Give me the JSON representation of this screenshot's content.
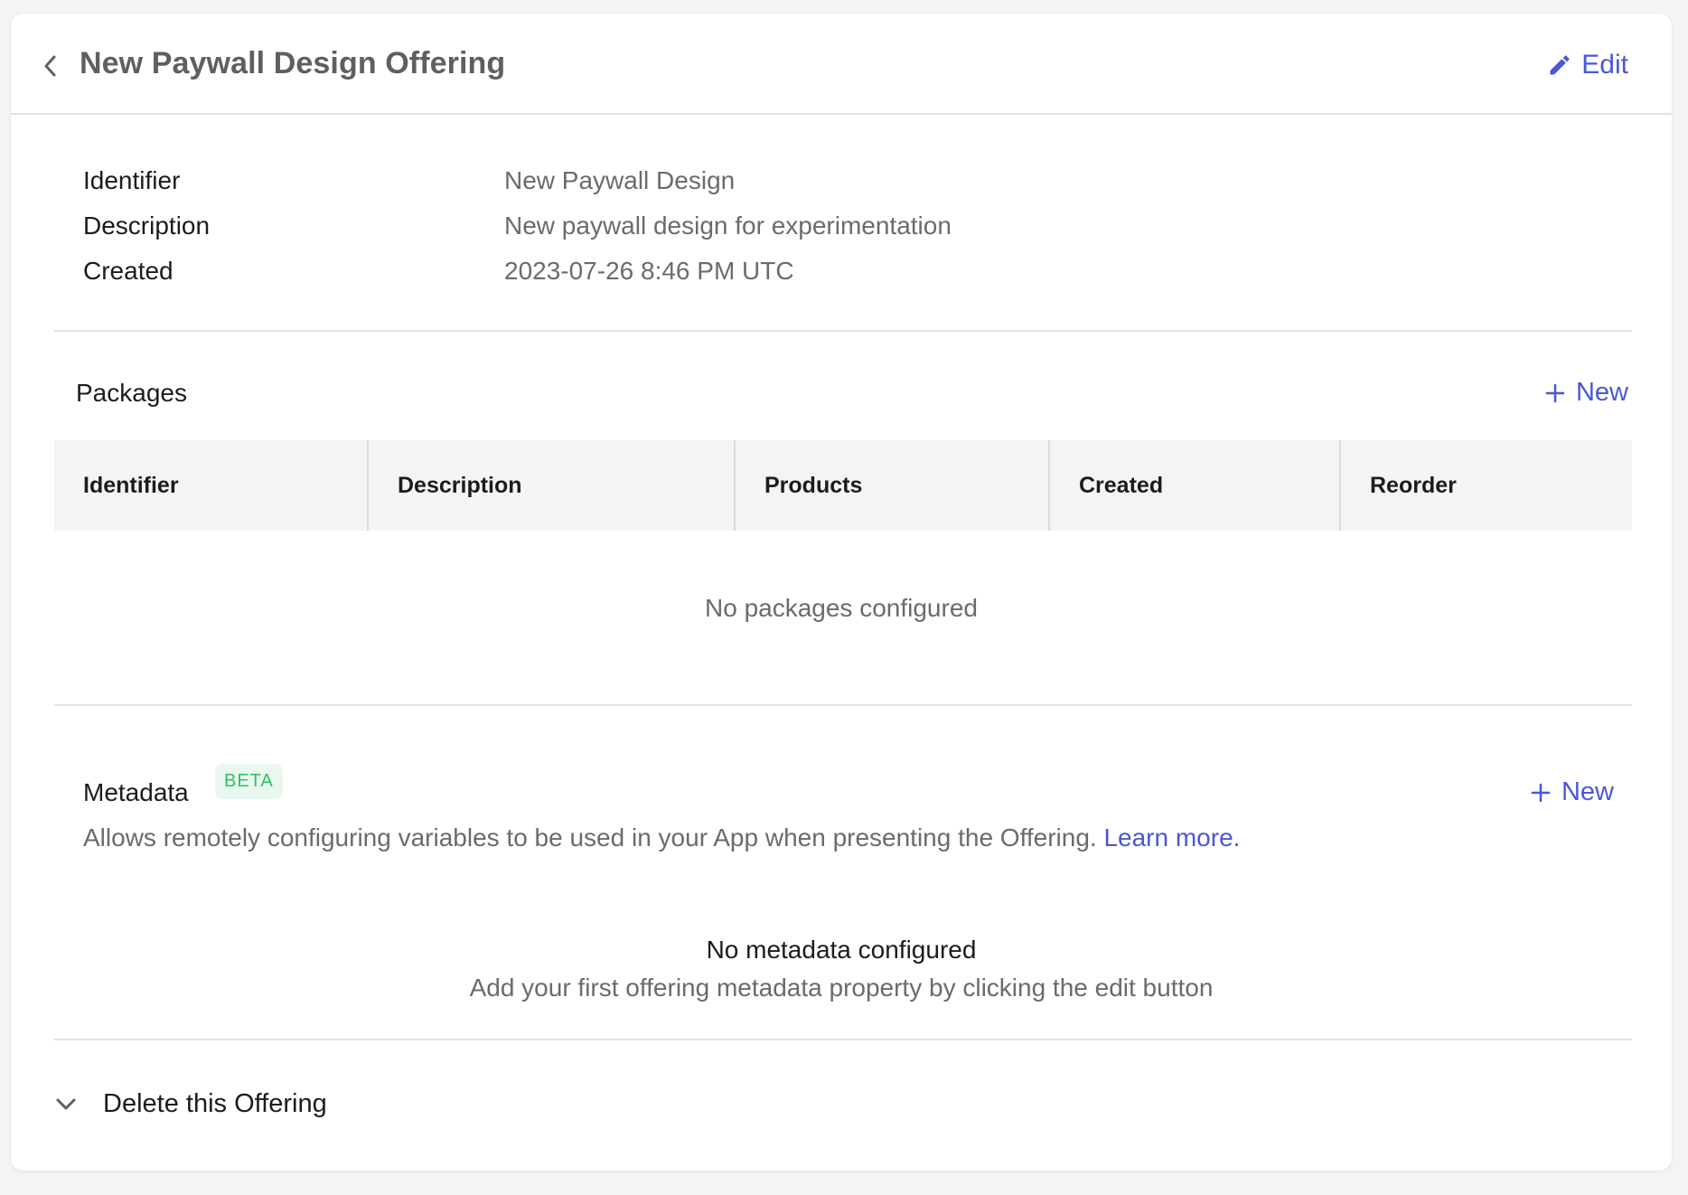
{
  "header": {
    "title": "New Paywall Design Offering",
    "edit_label": "Edit"
  },
  "info": [
    {
      "label": "Identifier",
      "value": "New Paywall Design"
    },
    {
      "label": "Description",
      "value": "New paywall design for experimentation"
    },
    {
      "label": "Created",
      "value": "2023-07-26 8:46 PM UTC"
    }
  ],
  "packages": {
    "title": "Packages",
    "new_label": "New",
    "columns": [
      "Identifier",
      "Description",
      "Products",
      "Created",
      "Reorder"
    ],
    "empty_text": "No packages configured"
  },
  "metadata": {
    "title": "Metadata",
    "badge": "BETA",
    "new_label": "New",
    "description": "Allows remotely configuring variables to be used in your App when presenting the Offering.",
    "learn_more": "Learn more.",
    "empty_title": "No metadata configured",
    "empty_subtitle": "Add your first offering metadata property by clicking the edit button"
  },
  "delete": {
    "label": "Delete this Offering"
  },
  "colors": {
    "accent": "#4a57d6",
    "beta_text": "#2fbf63",
    "beta_bg": "#e9f8ee"
  },
  "icons": {
    "back": "chevron-left-icon",
    "edit": "pencil-icon",
    "add": "plus-icon",
    "expand": "chevron-down-icon"
  }
}
